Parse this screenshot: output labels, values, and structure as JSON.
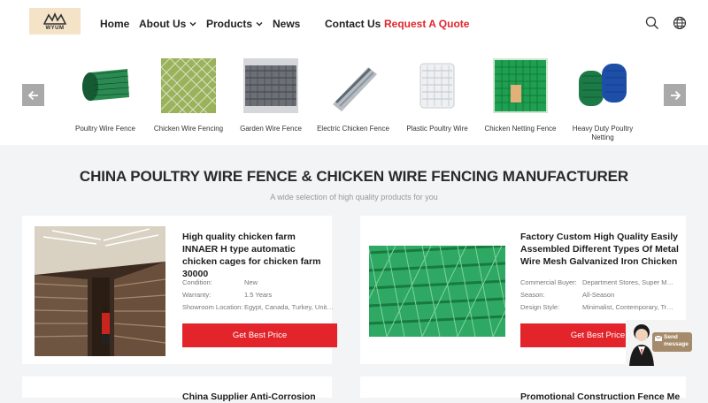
{
  "header": {
    "logo_text": "WYUM",
    "nav": [
      {
        "label": "Home",
        "dropdown": false
      },
      {
        "label": "About Us",
        "dropdown": true
      },
      {
        "label": "Products",
        "dropdown": true
      },
      {
        "label": "News",
        "dropdown": false
      },
      {
        "label": "Contact Us",
        "dropdown": false
      },
      {
        "label": "Request A Quote",
        "dropdown": false
      }
    ],
    "icons": [
      "search-icon",
      "globe-icon"
    ]
  },
  "categories": [
    {
      "label": "Poultry Wire Fence"
    },
    {
      "label": "Chicken Wire Fencing"
    },
    {
      "label": "Garden Wire Fence"
    },
    {
      "label": "Electric Chicken Fence"
    },
    {
      "label": "Plastic Poultry Wire"
    },
    {
      "label": "Chicken Netting Fence"
    },
    {
      "label": "Heavy Duty Poultry Netting"
    }
  ],
  "section": {
    "title": "CHINA POULTRY WIRE FENCE & CHICKEN WIRE FENCING MANUFACTURER",
    "subtitle": "A wide selection of high quality products for you"
  },
  "products": [
    {
      "title": "High quality chicken farm INNAER H type automatic chicken cages for chicken farm 30000",
      "attrs": [
        {
          "k": "Condition:",
          "v": "New"
        },
        {
          "k": "Warranty:",
          "v": "1.5 Years"
        },
        {
          "k": "Showroom Location:",
          "v": "Egypt, Canada, Turkey, United ..."
        }
      ],
      "button": "Get Best Price"
    },
    {
      "title": "Factory Custom High Quality Easily Assembled Different Types Of Metal Wire Mesh Galvanized Iron Chicken",
      "attrs": [
        {
          "k": "Commercial Buyer:",
          "v": "Department Stores, Super Mar..."
        },
        {
          "k": "Season:",
          "v": "All-Season"
        },
        {
          "k": "Design Style:",
          "v": "Minimalist, Contemporary, Tra..."
        }
      ],
      "button": "Get Best Price"
    },
    {
      "title": "China Supplier Anti-Corrosion"
    },
    {
      "title": "Promotional Construction Fence Mesh"
    }
  ],
  "chat": {
    "label_line1": "Send",
    "label_line2": "message"
  },
  "colors": {
    "accent": "#e3242b",
    "quote_link": "#e0262f",
    "mesh_green": "#1a8a4a"
  }
}
